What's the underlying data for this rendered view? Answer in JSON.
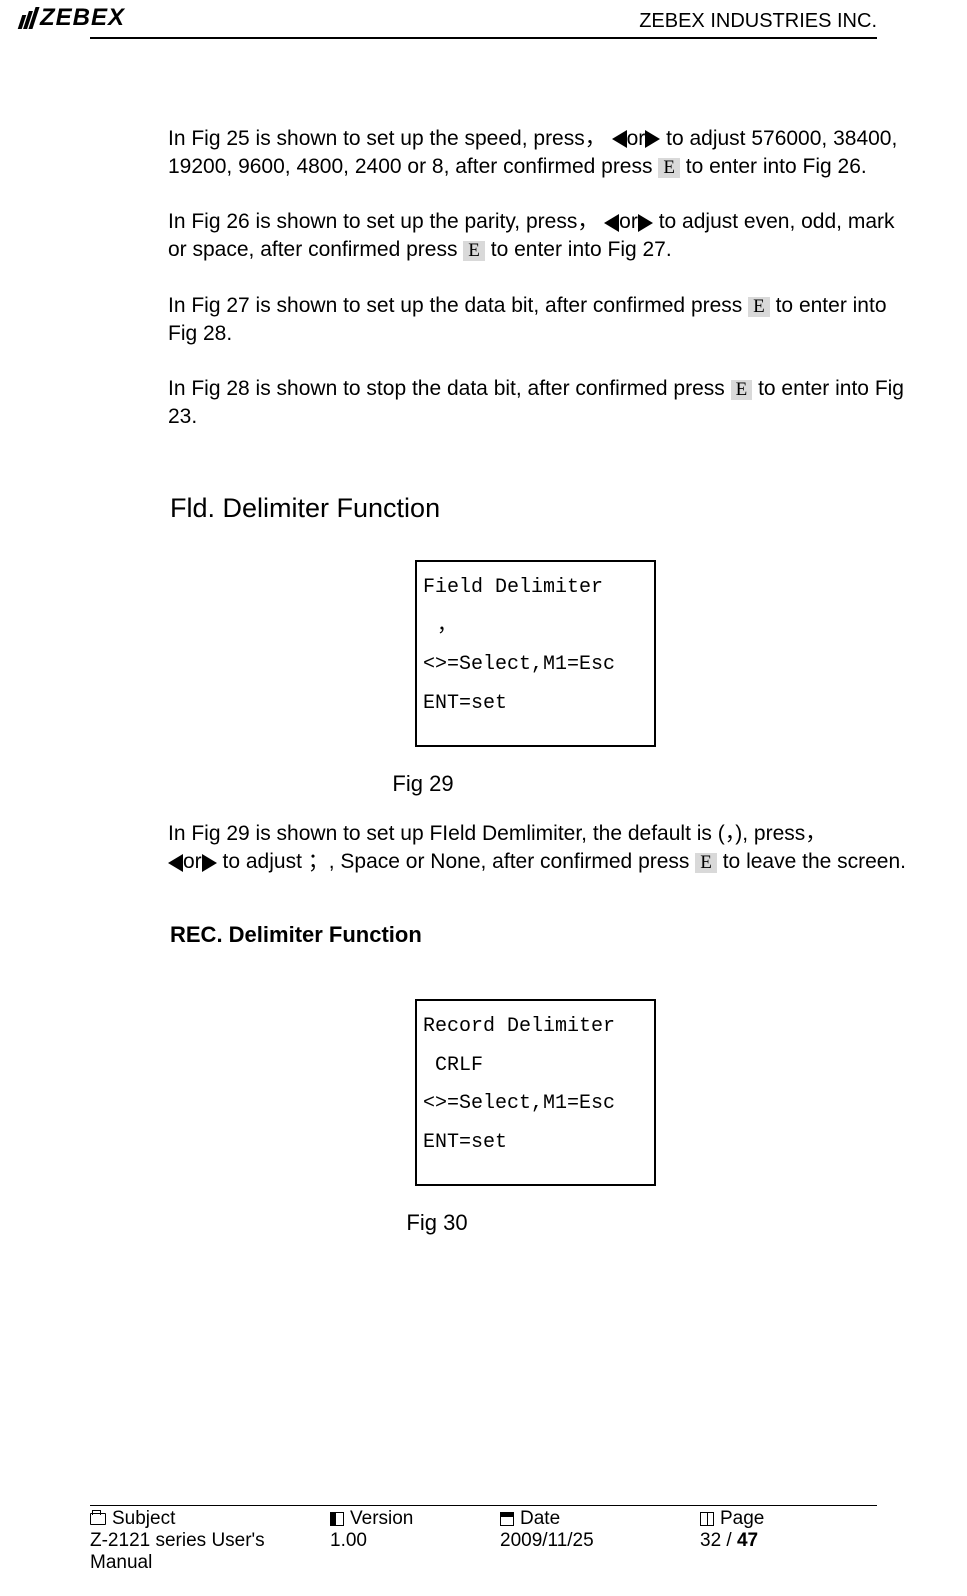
{
  "header": {
    "logo_text": "ZEBEX",
    "company": "ZEBEX INDUSTRIES INC."
  },
  "text": {
    "p1a": "In Fig 25 is shown to set up the speed, press，",
    "p1b": "or",
    "p1c": " to adjust 576000, 38400, 19200, 9600, 4800, 2400 or 8, after confirmed press ",
    "p1d": " to enter into Fig 26.",
    "p2a": "In Fig 26 is shown to set up the parity, press，",
    "p2b": "or",
    "p2c": " to adjust even, odd, mark or space, after confirmed press ",
    "p2d": " to enter into Fig 27.",
    "p3a": "In Fig 27 is shown to set up the data bit, after confirmed press ",
    "p3b": " to enter into Fig 28.",
    "p4a": "In Fig 28 is shown to stop the data bit, after confirmed press ",
    "p4b": " to enter into Fig 23.",
    "s1_title": "Fld. Delimiter Function",
    "fig29_cap": "Fig 29",
    "p5a": "In Fig 29 is shown to set up FIeld Demlimiter, the default is (，), press，",
    "p5b": "or",
    "p5c": " to adjust ；, Space or None, after confirmed press ",
    "p5d": " to leave the screen.",
    "s2_title": "REC. Delimiter Function",
    "fig30_cap": "Fig 30",
    "key_E": "E"
  },
  "lcd1": {
    "l1": "Field Delimiter",
    "l2": "，",
    "l3": "<>=Select,M1=Esc",
    "l4": "ENT=set"
  },
  "lcd2": {
    "l1": "Record Delimiter",
    "l2": " CRLF",
    "l3": "<>=Select,M1=Esc",
    "l4": "ENT=set"
  },
  "footer": {
    "labels": {
      "subject": "Subject",
      "version": "Version",
      "date": "Date",
      "page": "Page"
    },
    "values": {
      "subject": "Z-2121 series User's Manual",
      "version": "1.00",
      "date": "2009/11/25",
      "page_cur": "32",
      "page_sep": " / ",
      "page_total": "47"
    }
  }
}
